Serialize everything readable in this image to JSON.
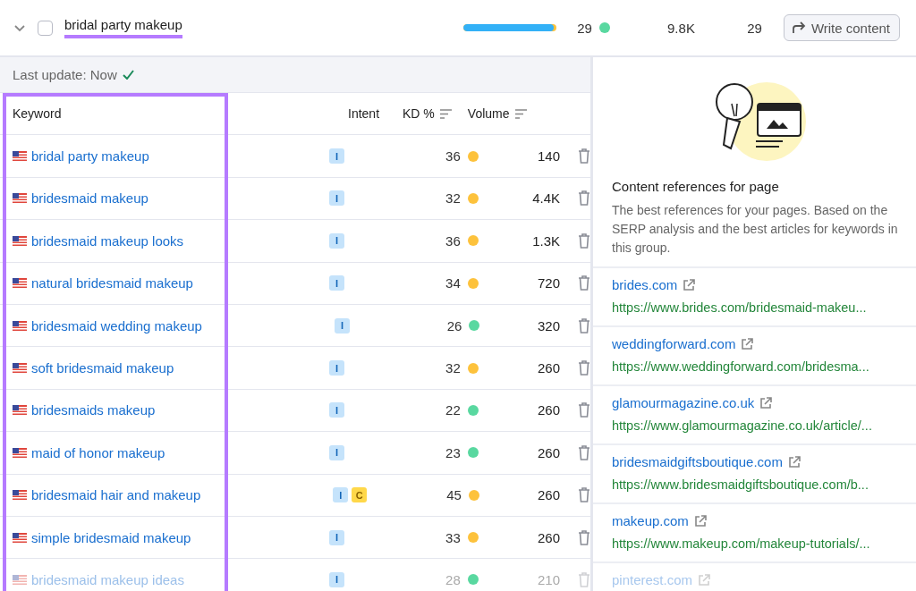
{
  "group": {
    "expanded": false,
    "checked": false,
    "title": "bridal party makeup",
    "level": 0.97,
    "kd": "29",
    "color": "#59d8a0",
    "volume": "9.8K",
    "count": "29",
    "button": "Write content"
  },
  "status": {
    "label": "Last update: Now"
  },
  "columns": [
    "Keyword",
    "Intent",
    "KD %",
    "Volume"
  ],
  "rows": [
    {
      "keyword": "bridal party makeup",
      "intents": [
        {
          "kind": "informational",
          "label": "I"
        }
      ],
      "kd": "36",
      "color": "#fdc23c",
      "volume": "140",
      "faded": false
    },
    {
      "keyword": "bridesmaid makeup",
      "intents": [
        {
          "kind": "informational",
          "label": "I"
        }
      ],
      "kd": "32",
      "color": "#fdc23c",
      "volume": "4.4K",
      "faded": false
    },
    {
      "keyword": "bridesmaid makeup looks",
      "intents": [
        {
          "kind": "informational",
          "label": "I"
        }
      ],
      "kd": "36",
      "color": "#fdc23c",
      "volume": "1.3K",
      "faded": false
    },
    {
      "keyword": "natural bridesmaid makeup",
      "intents": [
        {
          "kind": "informational",
          "label": "I"
        }
      ],
      "kd": "34",
      "color": "#fdc23c",
      "volume": "720",
      "faded": false
    },
    {
      "keyword": "bridesmaid wedding makeup",
      "intents": [
        {
          "kind": "informational",
          "label": "I"
        }
      ],
      "kd": "26",
      "color": "#59d8a0",
      "volume": "320",
      "faded": false
    },
    {
      "keyword": "soft bridesmaid makeup",
      "intents": [
        {
          "kind": "informational",
          "label": "I"
        }
      ],
      "kd": "32",
      "color": "#fdc23c",
      "volume": "260",
      "faded": false
    },
    {
      "keyword": "bridesmaids makeup",
      "intents": [
        {
          "kind": "informational",
          "label": "I"
        }
      ],
      "kd": "22",
      "color": "#59d8a0",
      "volume": "260",
      "faded": false
    },
    {
      "keyword": "maid of honor makeup",
      "intents": [
        {
          "kind": "informational",
          "label": "I"
        }
      ],
      "kd": "23",
      "color": "#59d8a0",
      "volume": "260",
      "faded": false
    },
    {
      "keyword": "bridesmaid hair and makeup",
      "intents": [
        {
          "kind": "informational",
          "label": "I"
        },
        {
          "kind": "commercial",
          "label": "C"
        }
      ],
      "kd": "45",
      "color": "#fdc23c",
      "volume": "260",
      "faded": false
    },
    {
      "keyword": "simple bridesmaid makeup",
      "intents": [
        {
          "kind": "informational",
          "label": "I"
        }
      ],
      "kd": "33",
      "color": "#fdc23c",
      "volume": "260",
      "faded": false
    },
    {
      "keyword": "bridesmaid makeup ideas",
      "intents": [
        {
          "kind": "informational",
          "label": "I"
        }
      ],
      "kd": "28",
      "color": "#59d8a0",
      "volume": "210",
      "faded": true
    }
  ],
  "references": {
    "title": "Content references for page",
    "description": "The best references for your pages. Based on the SERP analysis and the best articles for keywords in this group.",
    "items": [
      {
        "domain": "brides.com",
        "url": "https://www.brides.com/bridesmaid-makeu...",
        "faded": false
      },
      {
        "domain": "weddingforward.com",
        "url": "https://www.weddingforward.com/bridesma...",
        "faded": false
      },
      {
        "domain": "glamourmagazine.co.uk",
        "url": "https://www.glamourmagazine.co.uk/article/...",
        "faded": false
      },
      {
        "domain": "bridesmaidgiftsboutique.com",
        "url": "https://www.bridesmaidgiftsboutique.com/b...",
        "faded": false
      },
      {
        "domain": "makeup.com",
        "url": "https://www.makeup.com/makeup-tutorials/...",
        "faded": false
      },
      {
        "domain": "pinterest.com",
        "faded": true
      }
    ]
  }
}
